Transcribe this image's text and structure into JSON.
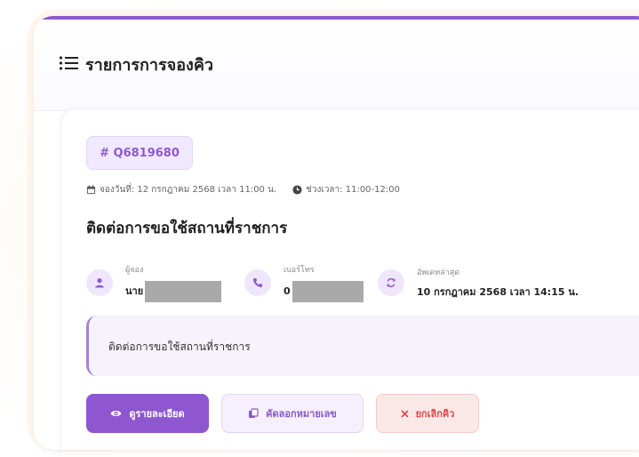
{
  "colors": {
    "accent": "#8e5ad0",
    "danger": "#e0454b",
    "badge_bg": "#f1e9ff"
  },
  "header": {
    "icon": "list-icon",
    "title": "รายการการจองคิว"
  },
  "booking": {
    "code": "# Q6819680",
    "booking_date": "จองวันที่: 12 กรกฎาคม 2568 เวลา 11:00 น.",
    "time_slot": "ช่วงเวลา: 11:00-12:00",
    "title": "ติดต่อการขอใช้สถานที่ราชการ",
    "booker": {
      "label": "ผู้จอง",
      "value": "นาย"
    },
    "phone": {
      "label": "เบอร์โทร",
      "value": "0"
    },
    "updated": {
      "label": "อัพเดทล่าสุด",
      "value": "10 กรกฎาคม 2568 เวลา 14:15 น."
    },
    "note": "ติดต่อการขอใช้สถานที่ราชการ"
  },
  "actions": {
    "view_label": "ดูรายละเอียด",
    "copy_label": "คัดลอกหมายเลข",
    "cancel_label": "ยกเลิกคิว"
  }
}
